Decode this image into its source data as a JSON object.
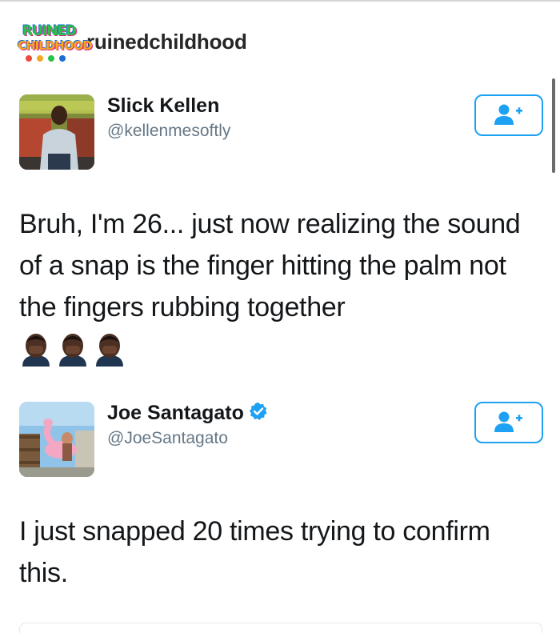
{
  "instagram": {
    "username": "ruinedchildhood",
    "logo_text_top": "RUINED",
    "logo_text_bottom": "CHILDHOOD",
    "logo_icon": "ruined-childhood-logo"
  },
  "tweets": [
    {
      "name": "Slick Kellen",
      "handle": "@kellenmesoftly",
      "verified": false,
      "text": "Bruh, I'm 26... just now realizing the sound of a snap is the finger hitting the palm not the fingers rubbing together",
      "emoji": [
        "person-facepalm-emoji",
        "person-facepalm-emoji",
        "person-facepalm-emoji"
      ],
      "follow_icon": "add-user-icon"
    },
    {
      "name": "Joe Santagato",
      "handle": "@JoeSantagato",
      "verified": true,
      "text": "I just snapped 20 times trying to confirm this.",
      "follow_icon": "add-user-icon"
    }
  ],
  "colors": {
    "twitter_blue": "#1da1f2",
    "text": "#14171a",
    "secondary": "#657786",
    "emoji_skin": "#5a3a2a"
  }
}
